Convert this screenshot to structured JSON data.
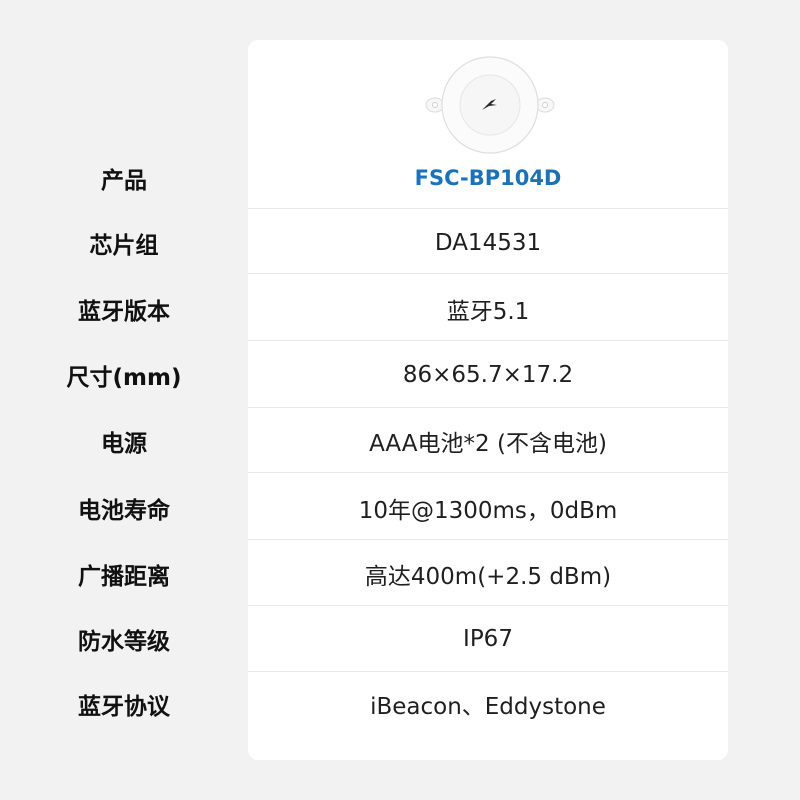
{
  "product_image": {
    "icon": "bluetooth-beacon-device-icon"
  },
  "colors": {
    "accent": "#1a73b8",
    "background": "#f2f2f2",
    "card": "#ffffff"
  },
  "specs": [
    {
      "label": "产品",
      "value": "FSC-BP104D"
    },
    {
      "label": "芯片组",
      "value": "DA14531"
    },
    {
      "label": "蓝牙版本",
      "value": "蓝牙5.1"
    },
    {
      "label": "尺寸(mm)",
      "value": "86×65.7×17.2"
    },
    {
      "label": "电源",
      "value": "AAA电池*2 (不含电池)"
    },
    {
      "label": "电池寿命",
      "value": "10年@1300ms，0dBm"
    },
    {
      "label": "广播距离",
      "value": "高达400m(+2.5 dBm)"
    },
    {
      "label": "防水等级",
      "value": "IP67"
    },
    {
      "label": "蓝牙协议",
      "value": "iBeacon、Eddystone"
    }
  ]
}
